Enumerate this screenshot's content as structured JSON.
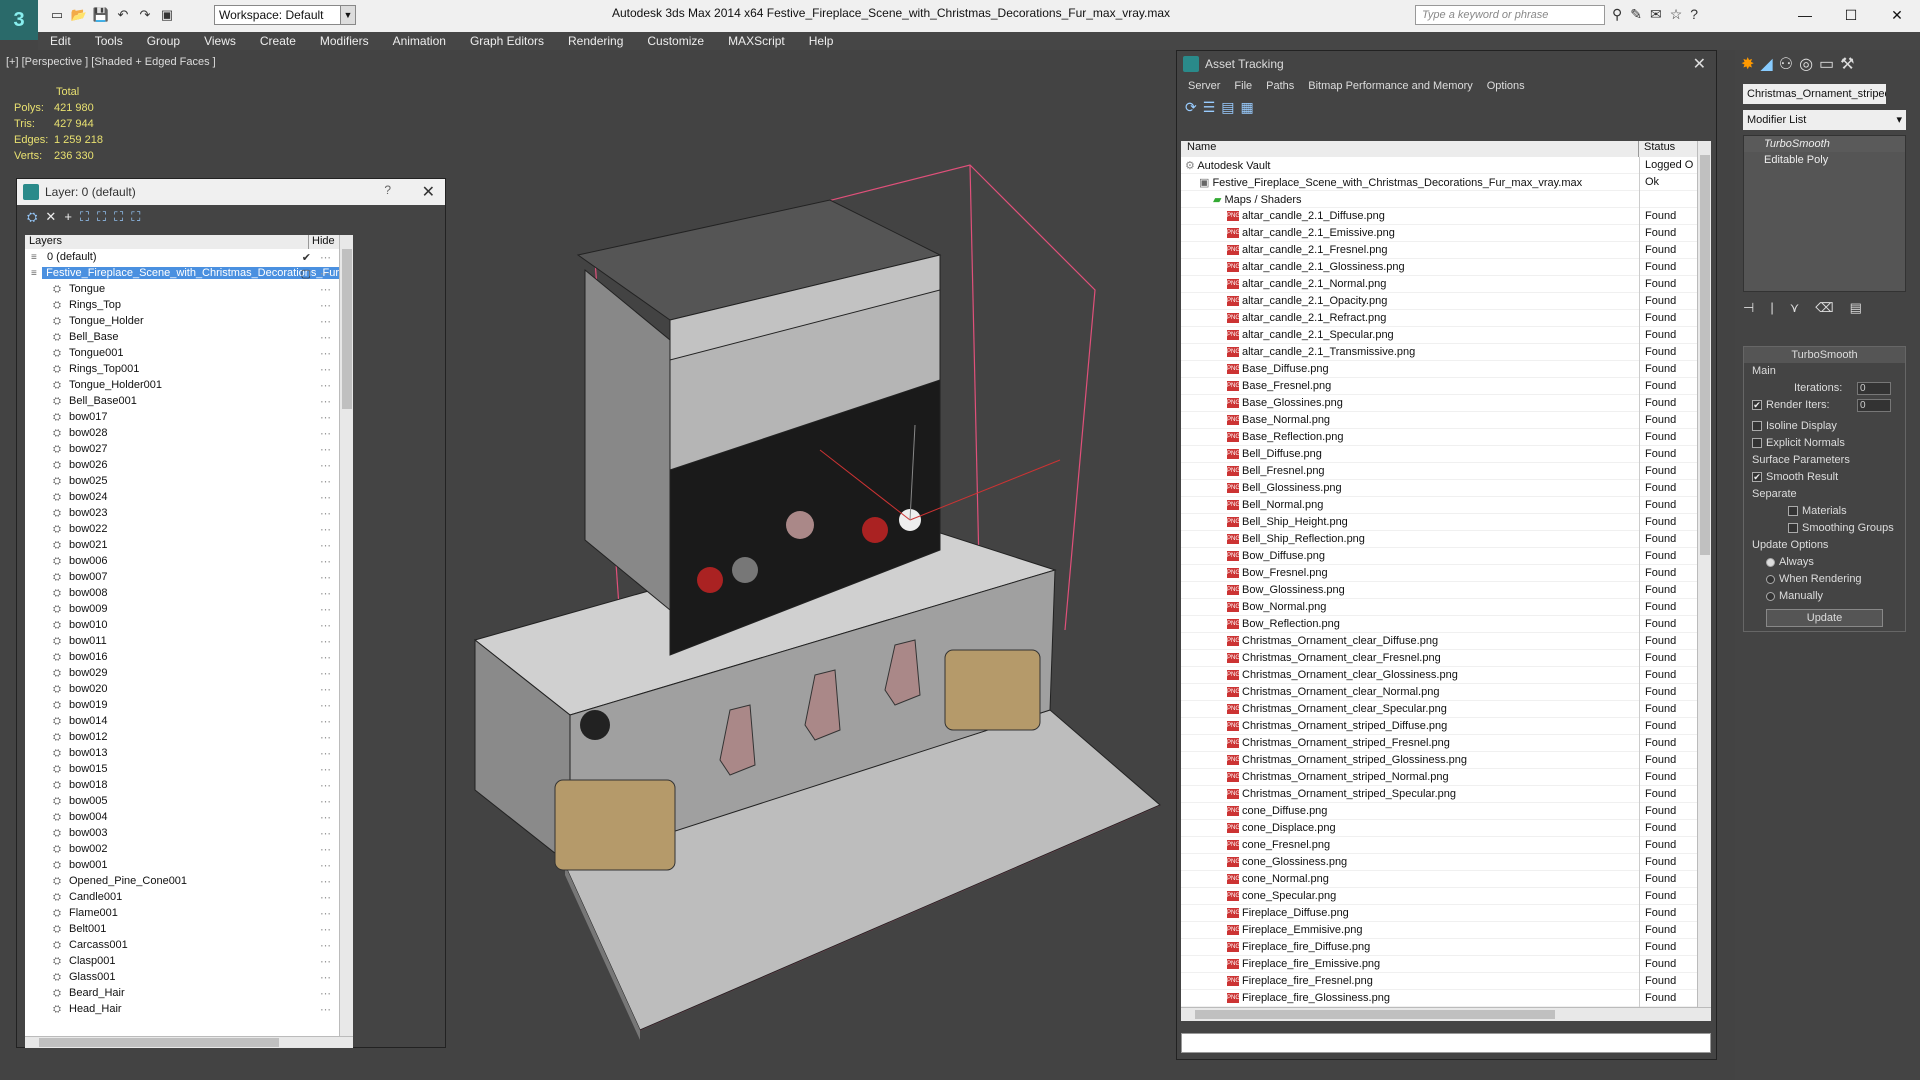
{
  "app": {
    "logo_text": "3",
    "workspace": "Workspace: Default",
    "title": "Autodesk 3ds Max  2014 x64      Festive_Fireplace_Scene_with_Christmas_Decorations_Fur_max_vray.max",
    "search_placeholder": "Type a keyword or phrase"
  },
  "menu": [
    "Edit",
    "Tools",
    "Group",
    "Views",
    "Create",
    "Modifiers",
    "Animation",
    "Graph Editors",
    "Rendering",
    "Customize",
    "MAXScript",
    "Help"
  ],
  "viewport": {
    "label": "[+] [Perspective ] [Shaded + Edged Faces ]",
    "stats": {
      "header": "Total",
      "rows": [
        {
          "k": "Polys:",
          "v": "421 980"
        },
        {
          "k": "Tris:",
          "v": "427 944"
        },
        {
          "k": "Edges:",
          "v": "1 259 218"
        },
        {
          "k": "Verts:",
          "v": "236 330"
        }
      ]
    }
  },
  "layer_panel": {
    "title": "Layer: 0 (default)",
    "help": "?",
    "col_layers": "Layers",
    "col_hide": "Hide",
    "rows": [
      {
        "label": "0 (default)",
        "indent": 1,
        "sel": false,
        "check": "✔"
      },
      {
        "label": "Festive_Fireplace_Scene_with_Christmas_Decorations_Fur",
        "indent": 1,
        "sel": true,
        "check": "▢"
      },
      {
        "label": "Tongue",
        "indent": 2
      },
      {
        "label": "Rings_Top",
        "indent": 2
      },
      {
        "label": "Tongue_Holder",
        "indent": 2
      },
      {
        "label": "Bell_Base",
        "indent": 2
      },
      {
        "label": "Tongue001",
        "indent": 2
      },
      {
        "label": "Rings_Top001",
        "indent": 2
      },
      {
        "label": "Tongue_Holder001",
        "indent": 2
      },
      {
        "label": "Bell_Base001",
        "indent": 2
      },
      {
        "label": "bow017",
        "indent": 2
      },
      {
        "label": "bow028",
        "indent": 2
      },
      {
        "label": "bow027",
        "indent": 2
      },
      {
        "label": "bow026",
        "indent": 2
      },
      {
        "label": "bow025",
        "indent": 2
      },
      {
        "label": "bow024",
        "indent": 2
      },
      {
        "label": "bow023",
        "indent": 2
      },
      {
        "label": "bow022",
        "indent": 2
      },
      {
        "label": "bow021",
        "indent": 2
      },
      {
        "label": "bow006",
        "indent": 2
      },
      {
        "label": "bow007",
        "indent": 2
      },
      {
        "label": "bow008",
        "indent": 2
      },
      {
        "label": "bow009",
        "indent": 2
      },
      {
        "label": "bow010",
        "indent": 2
      },
      {
        "label": "bow011",
        "indent": 2
      },
      {
        "label": "bow016",
        "indent": 2
      },
      {
        "label": "bow029",
        "indent": 2
      },
      {
        "label": "bow020",
        "indent": 2
      },
      {
        "label": "bow019",
        "indent": 2
      },
      {
        "label": "bow014",
        "indent": 2
      },
      {
        "label": "bow012",
        "indent": 2
      },
      {
        "label": "bow013",
        "indent": 2
      },
      {
        "label": "bow015",
        "indent": 2
      },
      {
        "label": "bow018",
        "indent": 2
      },
      {
        "label": "bow005",
        "indent": 2
      },
      {
        "label": "bow004",
        "indent": 2
      },
      {
        "label": "bow003",
        "indent": 2
      },
      {
        "label": "bow002",
        "indent": 2
      },
      {
        "label": "bow001",
        "indent": 2
      },
      {
        "label": "Opened_Pine_Cone001",
        "indent": 2
      },
      {
        "label": "Candle001",
        "indent": 2
      },
      {
        "label": "Flame001",
        "indent": 2
      },
      {
        "label": "Belt001",
        "indent": 2
      },
      {
        "label": "Carcass001",
        "indent": 2
      },
      {
        "label": "Clasp001",
        "indent": 2
      },
      {
        "label": "Glass001",
        "indent": 2
      },
      {
        "label": "Beard_Hair",
        "indent": 2
      },
      {
        "label": "Head_Hair",
        "indent": 2
      }
    ]
  },
  "asset_panel": {
    "title": "Asset Tracking",
    "menu": [
      "Server",
      "File",
      "Paths",
      "Bitmap Performance and Memory",
      "Options"
    ],
    "col_name": "Name",
    "col_status": "Status",
    "rows": [
      {
        "name": "Autodesk Vault",
        "status": "Logged O",
        "indent": 0,
        "type": "vault"
      },
      {
        "name": "Festive_Fireplace_Scene_with_Christmas_Decorations_Fur_max_vray.max",
        "status": "Ok",
        "indent": 1,
        "type": "max"
      },
      {
        "name": "Maps / Shaders",
        "status": "",
        "indent": 2,
        "type": "folder"
      },
      {
        "name": "altar_candle_2.1_Diffuse.png",
        "status": "Found",
        "indent": 3,
        "type": "png"
      },
      {
        "name": "altar_candle_2.1_Emissive.png",
        "status": "Found",
        "indent": 3,
        "type": "png"
      },
      {
        "name": "altar_candle_2.1_Fresnel.png",
        "status": "Found",
        "indent": 3,
        "type": "png"
      },
      {
        "name": "altar_candle_2.1_Glossiness.png",
        "status": "Found",
        "indent": 3,
        "type": "png"
      },
      {
        "name": "altar_candle_2.1_Normal.png",
        "status": "Found",
        "indent": 3,
        "type": "png"
      },
      {
        "name": "altar_candle_2.1_Opacity.png",
        "status": "Found",
        "indent": 3,
        "type": "png"
      },
      {
        "name": "altar_candle_2.1_Refract.png",
        "status": "Found",
        "indent": 3,
        "type": "png"
      },
      {
        "name": "altar_candle_2.1_Specular.png",
        "status": "Found",
        "indent": 3,
        "type": "png"
      },
      {
        "name": "altar_candle_2.1_Transmissive.png",
        "status": "Found",
        "indent": 3,
        "type": "png"
      },
      {
        "name": "Base_Diffuse.png",
        "status": "Found",
        "indent": 3,
        "type": "png"
      },
      {
        "name": "Base_Fresnel.png",
        "status": "Found",
        "indent": 3,
        "type": "png"
      },
      {
        "name": "Base_Glossines.png",
        "status": "Found",
        "indent": 3,
        "type": "png"
      },
      {
        "name": "Base_Normal.png",
        "status": "Found",
        "indent": 3,
        "type": "png"
      },
      {
        "name": "Base_Reflection.png",
        "status": "Found",
        "indent": 3,
        "type": "png"
      },
      {
        "name": "Bell_Diffuse.png",
        "status": "Found",
        "indent": 3,
        "type": "png"
      },
      {
        "name": "Bell_Fresnel.png",
        "status": "Found",
        "indent": 3,
        "type": "png"
      },
      {
        "name": "Bell_Glossiness.png",
        "status": "Found",
        "indent": 3,
        "type": "png"
      },
      {
        "name": "Bell_Normal.png",
        "status": "Found",
        "indent": 3,
        "type": "png"
      },
      {
        "name": "Bell_Ship_Height.png",
        "status": "Found",
        "indent": 3,
        "type": "png"
      },
      {
        "name": "Bell_Ship_Reflection.png",
        "status": "Found",
        "indent": 3,
        "type": "png"
      },
      {
        "name": "Bow_Diffuse.png",
        "status": "Found",
        "indent": 3,
        "type": "png"
      },
      {
        "name": "Bow_Fresnel.png",
        "status": "Found",
        "indent": 3,
        "type": "png"
      },
      {
        "name": "Bow_Glossiness.png",
        "status": "Found",
        "indent": 3,
        "type": "png"
      },
      {
        "name": "Bow_Normal.png",
        "status": "Found",
        "indent": 3,
        "type": "png"
      },
      {
        "name": "Bow_Reflection.png",
        "status": "Found",
        "indent": 3,
        "type": "png"
      },
      {
        "name": "Christmas_Ornament_clear_Diffuse.png",
        "status": "Found",
        "indent": 3,
        "type": "png"
      },
      {
        "name": "Christmas_Ornament_clear_Fresnel.png",
        "status": "Found",
        "indent": 3,
        "type": "png"
      },
      {
        "name": "Christmas_Ornament_clear_Glossiness.png",
        "status": "Found",
        "indent": 3,
        "type": "png"
      },
      {
        "name": "Christmas_Ornament_clear_Normal.png",
        "status": "Found",
        "indent": 3,
        "type": "png"
      },
      {
        "name": "Christmas_Ornament_clear_Specular.png",
        "status": "Found",
        "indent": 3,
        "type": "png"
      },
      {
        "name": "Christmas_Ornament_striped_Diffuse.png",
        "status": "Found",
        "indent": 3,
        "type": "png"
      },
      {
        "name": "Christmas_Ornament_striped_Fresnel.png",
        "status": "Found",
        "indent": 3,
        "type": "png"
      },
      {
        "name": "Christmas_Ornament_striped_Glossiness.png",
        "status": "Found",
        "indent": 3,
        "type": "png"
      },
      {
        "name": "Christmas_Ornament_striped_Normal.png",
        "status": "Found",
        "indent": 3,
        "type": "png"
      },
      {
        "name": "Christmas_Ornament_striped_Specular.png",
        "status": "Found",
        "indent": 3,
        "type": "png"
      },
      {
        "name": "cone_Diffuse.png",
        "status": "Found",
        "indent": 3,
        "type": "png"
      },
      {
        "name": "cone_Displace.png",
        "status": "Found",
        "indent": 3,
        "type": "png"
      },
      {
        "name": "cone_Fresnel.png",
        "status": "Found",
        "indent": 3,
        "type": "png"
      },
      {
        "name": "cone_Glossiness.png",
        "status": "Found",
        "indent": 3,
        "type": "png"
      },
      {
        "name": "cone_Normal.png",
        "status": "Found",
        "indent": 3,
        "type": "png"
      },
      {
        "name": "cone_Specular.png",
        "status": "Found",
        "indent": 3,
        "type": "png"
      },
      {
        "name": "Fireplace_Diffuse.png",
        "status": "Found",
        "indent": 3,
        "type": "png"
      },
      {
        "name": "Fireplace_Emmisive.png",
        "status": "Found",
        "indent": 3,
        "type": "png"
      },
      {
        "name": "Fireplace_fire_Diffuse.png",
        "status": "Found",
        "indent": 3,
        "type": "png"
      },
      {
        "name": "Fireplace_fire_Emissive.png",
        "status": "Found",
        "indent": 3,
        "type": "png"
      },
      {
        "name": "Fireplace_fire_Fresnel.png",
        "status": "Found",
        "indent": 3,
        "type": "png"
      },
      {
        "name": "Fireplace_fire_Glossiness.png",
        "status": "Found",
        "indent": 3,
        "type": "png"
      }
    ]
  },
  "command_panel": {
    "object_name": "Christmas_Ornament_striped",
    "modifier_list": "Modifier List",
    "stack": [
      "TurboSmooth",
      "Editable Poly"
    ],
    "turbosmooth": {
      "header": "TurboSmooth",
      "main": "Main",
      "iterations_label": "Iterations:",
      "iterations": "0",
      "render_iters_label": "Render Iters:",
      "render_iters": "0",
      "isoline": "Isoline Display",
      "explicit": "Explicit Normals",
      "surface": "Surface Parameters",
      "smooth_result": "Smooth Result",
      "separate": "Separate",
      "materials": "Materials",
      "smoothing_groups": "Smoothing Groups",
      "update_options": "Update Options",
      "always": "Always",
      "when_rendering": "When Rendering",
      "manually": "Manually",
      "update_btn": "Update"
    }
  }
}
